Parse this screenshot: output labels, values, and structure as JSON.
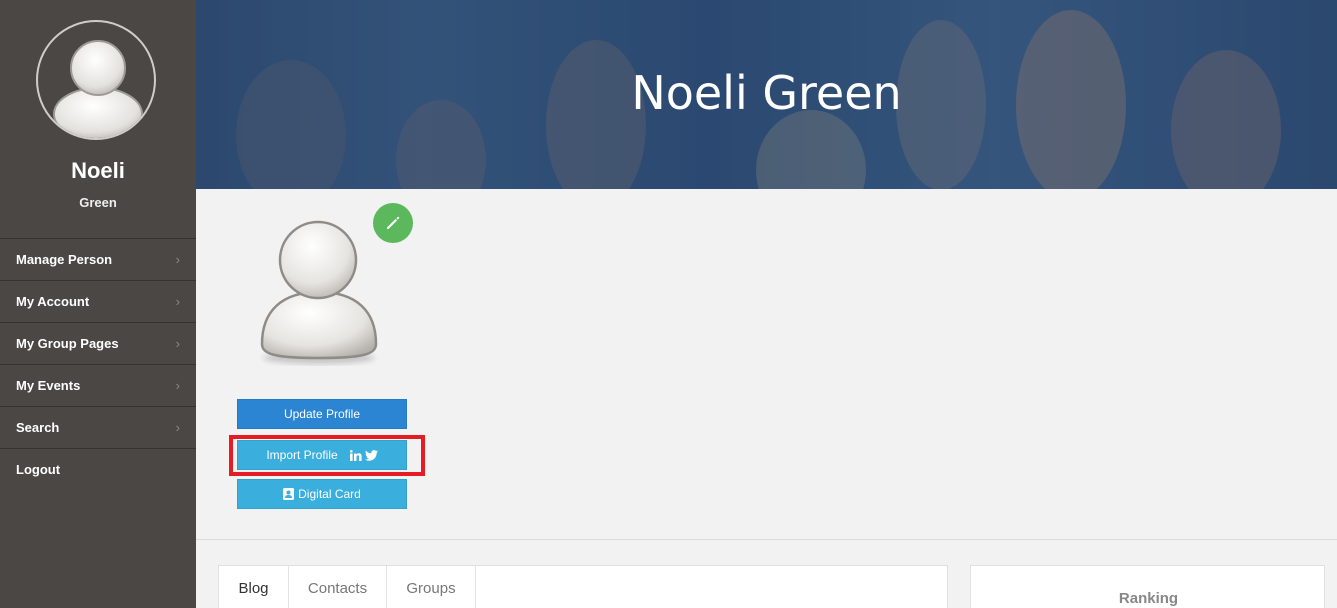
{
  "sidebar": {
    "name": "Noeli",
    "subname": "Green",
    "items": [
      {
        "label": "Manage Person",
        "chevron": "›"
      },
      {
        "label": "My Account",
        "chevron": "›"
      },
      {
        "label": "My Group Pages",
        "chevron": "›"
      },
      {
        "label": "My Events",
        "chevron": "›"
      },
      {
        "label": "Search",
        "chevron": "›"
      },
      {
        "label": "Logout",
        "chevron": ""
      }
    ]
  },
  "banner": {
    "title": "Noeli Green"
  },
  "profile": {
    "update_label": "Update Profile",
    "import_label": "Import Profile",
    "card_label": "Digital Card",
    "edit_icon": "pencil-icon",
    "social_icons": [
      "linkedin-icon",
      "twitter-icon"
    ]
  },
  "tabs": [
    {
      "label": "Blog",
      "active": true
    },
    {
      "label": "Contacts",
      "active": false
    },
    {
      "label": "Groups",
      "active": false
    }
  ],
  "ranking": {
    "title": "Ranking"
  },
  "colors": {
    "sidebar_bg": "#4a4745",
    "primary_button": "#2b85d2",
    "secondary_button": "#3aaedc",
    "edit_button": "#5cb85c",
    "highlight": "#e41c24"
  }
}
